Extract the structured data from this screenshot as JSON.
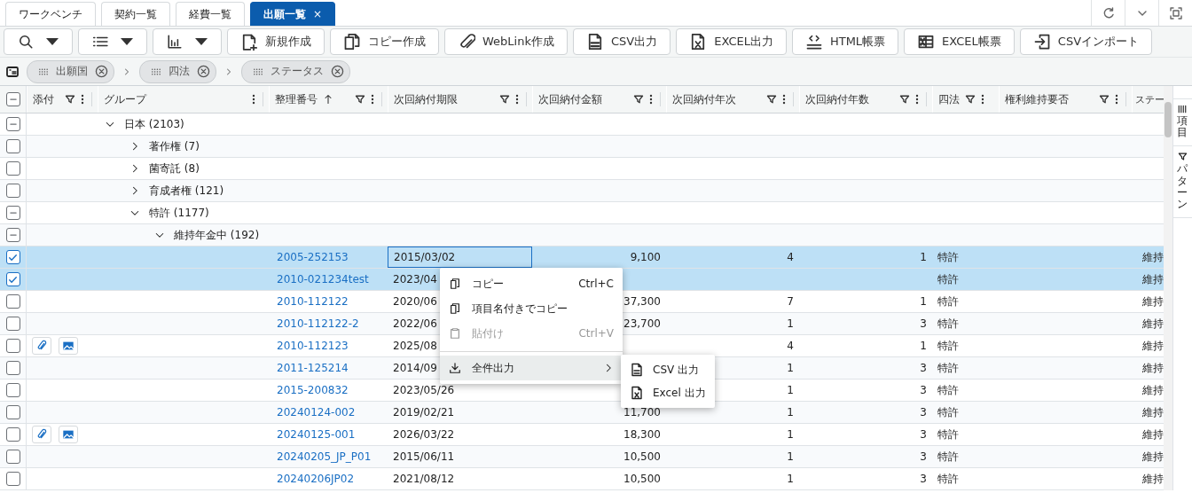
{
  "tabs": [
    {
      "label": "ワークベンチ",
      "selected": false
    },
    {
      "label": "契約一覧",
      "selected": false
    },
    {
      "label": "経費一覧",
      "selected": false
    },
    {
      "label": "出願一覧",
      "selected": true,
      "close": "×"
    }
  ],
  "toolbar": [
    {
      "kind": "dropdown"
    },
    {
      "kind": "dropdown"
    },
    {
      "kind": "dropdown"
    },
    {
      "kind": "button",
      "label": "新規作成"
    },
    {
      "kind": "button",
      "label": "コピー作成"
    },
    {
      "kind": "button",
      "label": "WebLink作成"
    },
    {
      "kind": "button",
      "label": "CSV出力"
    },
    {
      "kind": "button",
      "label": "EXCEL出力"
    },
    {
      "kind": "button",
      "label": "HTML帳票"
    },
    {
      "kind": "button",
      "label": "EXCEL帳票"
    },
    {
      "kind": "button",
      "label": "CSVインポート"
    }
  ],
  "grouping": [
    {
      "label": "出願国"
    },
    {
      "label": "四法"
    },
    {
      "label": "ステータス"
    }
  ],
  "header_checkbox": {
    "partial": true
  },
  "columns": [
    {
      "label": "添付",
      "filter": true,
      "menu": true
    },
    {
      "label": "グループ",
      "filter": false,
      "menu": true
    },
    {
      "label": "整理番号",
      "sort_ascending": true,
      "filter": true,
      "menu": true
    },
    {
      "label": "次回納付期限",
      "filter": true,
      "menu": true
    },
    {
      "label": "次回納付金額",
      "filter": true,
      "menu": true
    },
    {
      "label": "次回納付年次",
      "filter": true,
      "menu": true
    },
    {
      "label": "次回納付年数",
      "filter": true,
      "menu": true
    },
    {
      "label": "四法",
      "filter": true,
      "menu": true,
      "compact": true
    },
    {
      "label": "権利維持要否",
      "filter": true,
      "menu": true
    },
    {
      "label": "ステー",
      "filter": false,
      "menu": false
    }
  ],
  "tree": [
    {
      "label": "日本 (2103)",
      "expanded": true,
      "partial": true,
      "children": [
        {
          "label": "著作権 (7)",
          "expanded": false,
          "partial": false
        },
        {
          "label": "菌寄託 (8)",
          "expanded": false,
          "partial": false
        },
        {
          "label": "育成者権 (121)",
          "expanded": false,
          "partial": false
        },
        {
          "label": "特許 (1177)",
          "expanded": true,
          "partial": true,
          "children": [
            {
              "label": "維持年金中 (192)",
              "expanded": true,
              "partial": true,
              "records": [
                {
                  "checked": true,
                  "focused": true,
                  "attachments": false,
                  "number": "2005-252153",
                  "due": "2015/03/02",
                  "amount": "9,100",
                  "year": "4",
                  "count": "1",
                  "law": "特許",
                  "status": "維持"
                },
                {
                  "checked": true,
                  "focused": false,
                  "attachments": false,
                  "number": "2010-021234test",
                  "due": "2023/04",
                  "law": "特許",
                  "status": "維持"
                },
                {
                  "checked": false,
                  "focused": false,
                  "attachments": false,
                  "number": "2010-112122",
                  "due": "2020/06",
                  "amount": "37,300",
                  "year": "7",
                  "count": "1",
                  "law": "特許",
                  "status": "維持"
                },
                {
                  "checked": false,
                  "focused": false,
                  "attachments": false,
                  "number": "2010-112122-2",
                  "due": "2022/06",
                  "amount": "23,700",
                  "year": "1",
                  "count": "3",
                  "law": "特許",
                  "status": "維持"
                },
                {
                  "checked": false,
                  "focused": false,
                  "attachments": true,
                  "number": "2010-112123",
                  "due": "2025/08",
                  "year": "4",
                  "count": "1",
                  "law": "特許",
                  "status": "維持"
                },
                {
                  "checked": false,
                  "focused": false,
                  "attachments": false,
                  "number": "2011-125214",
                  "due": "2014/09",
                  "year": "1",
                  "count": "3",
                  "law": "特許",
                  "status": "維持"
                },
                {
                  "checked": false,
                  "focused": false,
                  "attachments": false,
                  "number": "2015-200832",
                  "due": "2023/05/26",
                  "year": "1",
                  "count": "3",
                  "law": "特許",
                  "status": "維持"
                },
                {
                  "checked": false,
                  "focused": false,
                  "attachments": false,
                  "number": "20240124-002",
                  "due": "2019/02/21",
                  "amount": "11,700",
                  "year": "1",
                  "count": "3",
                  "law": "特許",
                  "status": "維持"
                },
                {
                  "checked": false,
                  "focused": false,
                  "attachments": true,
                  "number": "20240125-001",
                  "due": "2026/03/22",
                  "amount": "18,300",
                  "year": "1",
                  "count": "3",
                  "law": "特許",
                  "status": "維持"
                },
                {
                  "checked": false,
                  "focused": false,
                  "attachments": false,
                  "number": "20240205_JP_P01",
                  "due": "2015/06/11",
                  "amount": "10,500",
                  "year": "1",
                  "count": "3",
                  "law": "特許",
                  "status": "維持"
                },
                {
                  "checked": false,
                  "focused": false,
                  "attachments": false,
                  "number": "20240206JP02",
                  "due": "2021/08/12",
                  "amount": "10,500",
                  "year": "1",
                  "count": "3",
                  "law": "特許",
                  "status": "維持"
                }
              ]
            }
          ]
        }
      ]
    }
  ],
  "side_panel": [
    {
      "label": "項目"
    },
    {
      "label": "パターン"
    }
  ],
  "context_menu": {
    "items": [
      {
        "kind": "item",
        "label": "コピー",
        "shortcut": "Ctrl+C",
        "disabled": false,
        "highlighted": false
      },
      {
        "kind": "item",
        "label": "項目名付きでコピー",
        "disabled": false,
        "highlighted": false
      },
      {
        "kind": "item",
        "label": "貼付け",
        "shortcut": "Ctrl+V",
        "disabled": true,
        "highlighted": false
      },
      {
        "kind": "separator"
      },
      {
        "kind": "submenu",
        "label": "全件出力",
        "disabled": false,
        "highlighted": true
      }
    ],
    "submenu": [
      {
        "label": "CSV 出力"
      },
      {
        "label": "Excel 出力"
      }
    ]
  }
}
